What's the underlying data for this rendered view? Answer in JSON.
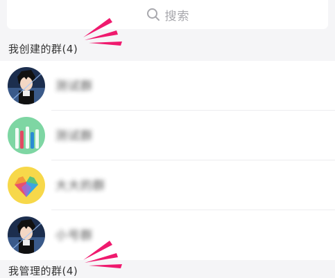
{
  "search": {
    "placeholder": "搜索",
    "icon": "search-icon"
  },
  "sections": {
    "created": {
      "title": "我创建的群(4)"
    },
    "managed": {
      "title": "我管理的群(4)"
    }
  },
  "groups": [
    {
      "name": "测试群",
      "avatar": "anime-avatar"
    },
    {
      "name": "测试群",
      "avatar": "toothbrush-avatar"
    },
    {
      "name": "大大的群",
      "avatar": "heart-avatar"
    },
    {
      "name": "小号群",
      "avatar": "anime-avatar"
    }
  ],
  "colors": {
    "accent": "#ef1a6e",
    "background": "#f5f5f7",
    "text": "#333333"
  }
}
